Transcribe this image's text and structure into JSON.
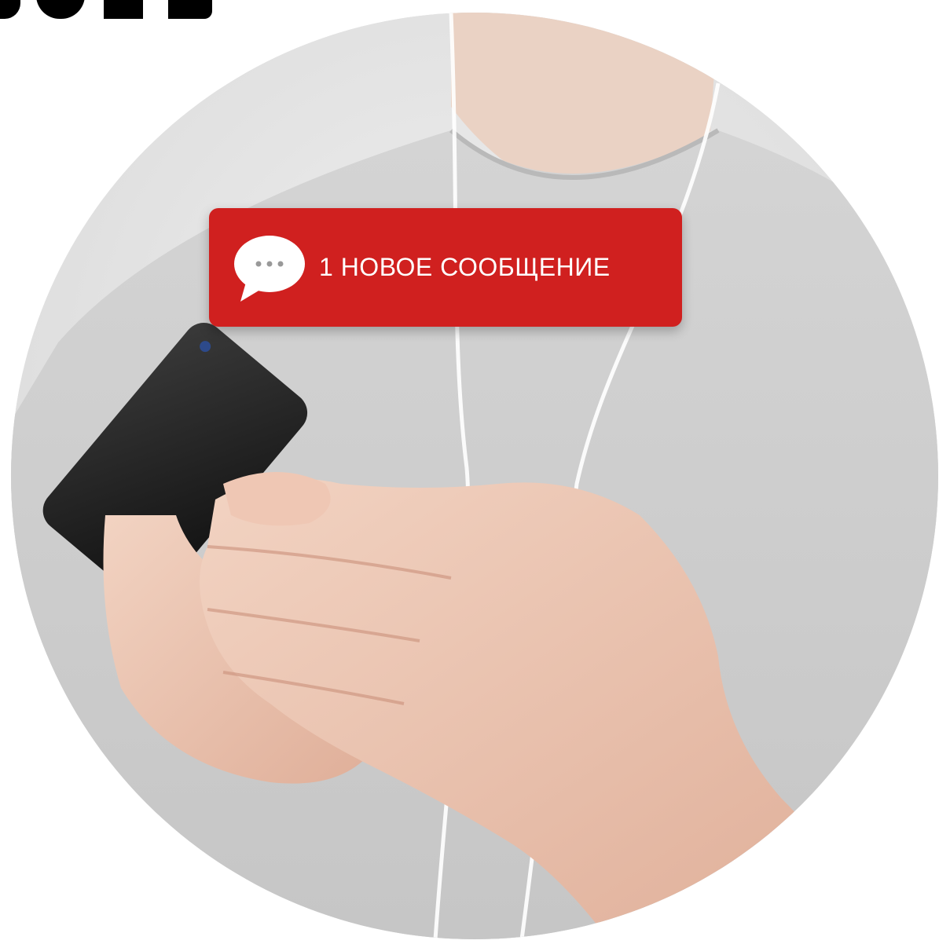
{
  "notification": {
    "text": "1 НОВОЕ СООБЩЕНИЕ",
    "icon": "chat-bubble-icon",
    "color": "#d0201f"
  },
  "photo": {
    "icon": "person-holding-smartphone-photo"
  }
}
